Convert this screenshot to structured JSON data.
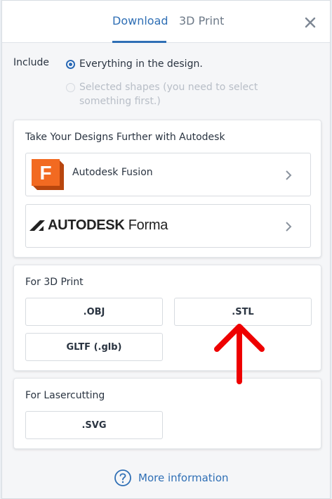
{
  "tabs": [
    {
      "label": "Download",
      "active": true
    },
    {
      "label": "3D Print",
      "active": false
    }
  ],
  "close_icon": "close-icon",
  "include": {
    "label": "Include",
    "options": [
      {
        "label": "Everything in the design.",
        "selected": true,
        "disabled": false
      },
      {
        "label": "Selected shapes (you need to select something first.)",
        "selected": false,
        "disabled": true
      }
    ]
  },
  "autodesk_card": {
    "title": "Take Your Designs Further with Autodesk",
    "fusion": {
      "logo_letter": "F",
      "label": "Autodesk Fusion"
    },
    "forma": {
      "brand": "AUTODESK",
      "product": "Forma"
    }
  },
  "print_card": {
    "title": "For 3D Print",
    "buttons": [
      ".OBJ",
      ".STL",
      "GLTF (.glb)"
    ]
  },
  "laser_card": {
    "title": "For Lasercutting",
    "buttons": [
      ".SVG"
    ]
  },
  "more_info": {
    "label": "More information",
    "icon": "help-circle-icon"
  },
  "colors": {
    "accent": "#2f6fb5",
    "fusion_orange": "#f26a21",
    "arrow_red": "#ee0000"
  }
}
